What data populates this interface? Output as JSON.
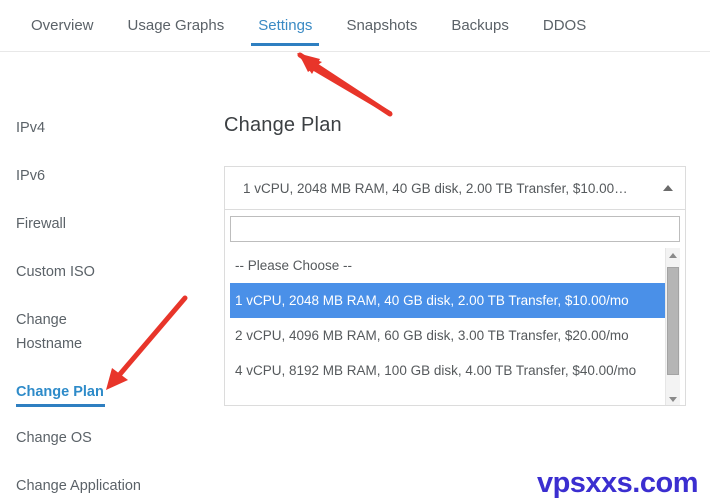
{
  "tabs": {
    "items": [
      {
        "label": "Overview",
        "active": false
      },
      {
        "label": "Usage Graphs",
        "active": false
      },
      {
        "label": "Settings",
        "active": true
      },
      {
        "label": "Snapshots",
        "active": false
      },
      {
        "label": "Backups",
        "active": false
      },
      {
        "label": "DDOS",
        "active": false
      }
    ],
    "active_label": "Settings"
  },
  "sidebar": {
    "items": [
      {
        "label": "IPv4",
        "active": false
      },
      {
        "label": "IPv6",
        "active": false
      },
      {
        "label": "Firewall",
        "active": false
      },
      {
        "label": "Custom ISO",
        "active": false
      },
      {
        "label": "Change Hostname",
        "active": false
      },
      {
        "label": "Change Plan",
        "active": true
      },
      {
        "label": "Change OS",
        "active": false
      },
      {
        "label": "Change Application",
        "active": false
      }
    ],
    "active_label": "Change Plan"
  },
  "main": {
    "title": "Change Plan",
    "select": {
      "selected_label": "1 vCPU, 2048 MB RAM, 40 GB disk, 2.00 TB Transfer, $10.00…",
      "caret_icon": "chevron-up-icon",
      "expanded": true,
      "search_value": "",
      "search_placeholder": "",
      "options": [
        {
          "label": "-- Please Choose --",
          "selected": false
        },
        {
          "label": "1 vCPU, 2048 MB RAM, 40 GB disk, 2.00 TB Transfer, $10.00/mo",
          "selected": true
        },
        {
          "label": "2 vCPU, 4096 MB RAM, 60 GB disk, 3.00 TB Transfer, $20.00/mo",
          "selected": false
        },
        {
          "label": "4 vCPU, 8192 MB RAM, 100 GB disk, 4.00 TB Transfer, $40.00/mo",
          "selected": false
        }
      ],
      "scrollbar": {
        "up_icon": "scroll-up-arrow-icon",
        "down_icon": "scroll-down-arrow-icon"
      }
    }
  },
  "annotations": {
    "arrow_to_settings_tab": "red-arrow-icon",
    "arrow_to_change_plan": "red-arrow-icon"
  },
  "watermark": {
    "text": "vpsxxs.com"
  },
  "colors": {
    "accent_blue": "#2e7fc1",
    "tab_active_text": "#3a8ac4",
    "option_selected_bg": "#4a90e8",
    "annotation_red": "#e8352a",
    "watermark": "#3b2ed0",
    "body_text": "#5b6268"
  }
}
